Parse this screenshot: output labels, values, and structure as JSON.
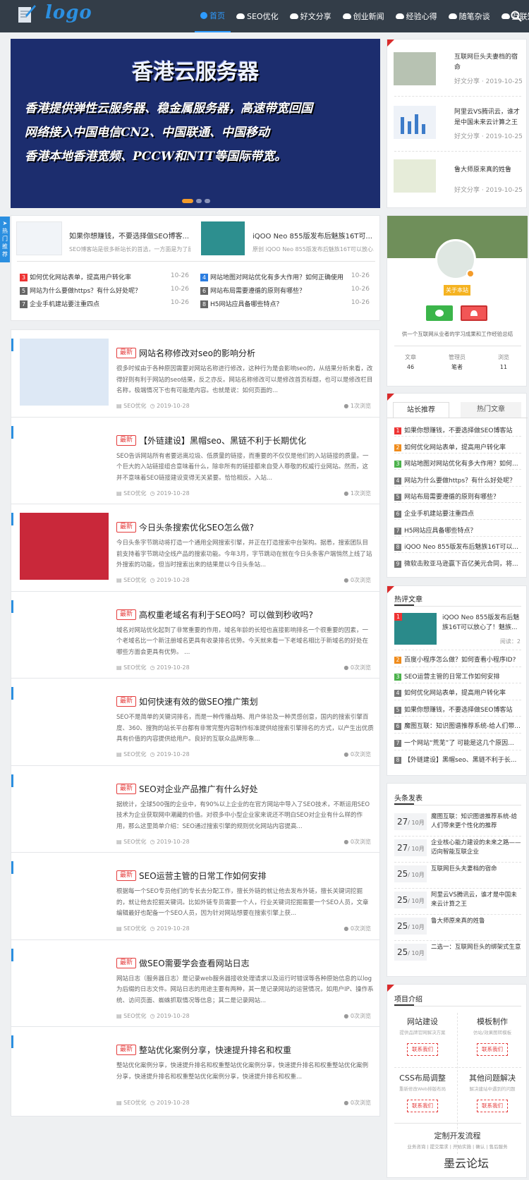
{
  "header": {
    "logo": "logo",
    "nav": [
      {
        "label": "首页"
      },
      {
        "label": "SEO优化"
      },
      {
        "label": "好文分享"
      },
      {
        "label": "创业新闻"
      },
      {
        "label": "经验心得"
      },
      {
        "label": "随笔杂谈"
      },
      {
        "label": "互联知识"
      }
    ]
  },
  "banner": {
    "title": "香港云服务器",
    "lines": [
      "香港提供弹性云服务器、稳金属服务器，高速带宽回国",
      "网络接入中国电信CN2、中国联通、中国移动",
      "香港本地香港宽频、PCCW和NTT等国际带宽。"
    ]
  },
  "recent_posts": [
    {
      "title": "互联网巨头夫妻档的宿命",
      "category": "好文分享",
      "date": "2019-10-25"
    },
    {
      "title": "阿里云VS腾讯云，谁才是中国未来云计算之王",
      "category": "好文分享",
      "date": "2019-10-25"
    },
    {
      "title": "鲁大师原来真的姓鲁",
      "category": "好文分享",
      "date": "2019-10-25"
    }
  ],
  "hot": {
    "tag": "热门推荐",
    "featured": [
      {
        "title": "如果你想赚钱，不要选择做SEO博客...",
        "desc": "SEO博客站是很多新站长的首选，一方面是为了展示..."
      },
      {
        "title": "iQOO Neo 855版发布后魅族16T可...",
        "desc": "原创 iQOO Neo 855版发布后魅族16T可以放心..."
      }
    ],
    "list": [
      {
        "n": "3",
        "title": "如何优化网站表单，提高用户转化率",
        "date": "10-26"
      },
      {
        "n": "4",
        "title": "网站地图对网站优化有多大作用？如何正确使用",
        "date": "10-26"
      },
      {
        "n": "5",
        "title": "网站为什么要做https？有什么好处呢？",
        "date": "10-26"
      },
      {
        "n": "6",
        "title": "网站布局需要遵循的原则有哪些？",
        "date": "10-26"
      },
      {
        "n": "7",
        "title": "企业手机建站要注重四点",
        "date": "10-26"
      },
      {
        "n": "8",
        "title": "H5网站应具备哪些特点？",
        "date": "10-26"
      }
    ]
  },
  "posts": [
    {
      "tag": "最新",
      "title": "网站名称修改对seo的影响分析",
      "excerpt": "很多时候由于各种原因需要对网站名称进行修改，这种行为是会影响seo的，从结果分析来看，改得好则有利于网站的seo结果，反之亦反。网站名称修改可以是修改首页标题，也可以是修改栏目名称，极端情况下也有可能是内容。也就是说：如何页面的...",
      "category": "SEO优化",
      "date": "2019-10-28",
      "views": "1次浏览"
    },
    {
      "tag": "最新",
      "title": "【外链建设】黑帽seo、黑链不利于长期优化",
      "excerpt": "SEO告诉网站所有者要远离垃圾、低质量的链接，而重要的不仅仅是他们的入站链接的质量。一个巨大的入站链接组合意味着什么，除非所有的链接都来自受人尊敬的权威行业网站。然而，这并不意味着SEO链接建设变得无关紧要。恰恰相反。入站...",
      "category": "SEO优化",
      "date": "2019-10-28",
      "views": "1次浏览"
    },
    {
      "tag": "最新",
      "title": "今日头条搜索优化SEO怎么做?",
      "excerpt": "今日头条字节跳动将打造一个通用全网搜索引擎，并正在打造搜索中台架构。据悉，搜索团队目前支持着字节跳动全线产品的搜索功能。今年3月，字节跳动在就在今日头条客户端悄然上线了站外搜索的功能，但当时搜索出来的结果是以今日头条站...",
      "category": "SEO优化",
      "date": "2019-10-28",
      "views": "0次浏览"
    },
    {
      "tag": "最新",
      "title": "高权重老域名有利于SEO吗？可以做到秒收吗?",
      "excerpt": "域名对网站优化起到了非常重要的作用，域名年龄的长短也直接影响排名一个很重要的因素，一个老域名比一个新注册域名更具有收录排名优势。今天就来看一下老域名相比于新域名的好处在哪些方面会更具有优势。 ...",
      "category": "SEO优化",
      "date": "2019-10-28",
      "views": "0次浏览"
    },
    {
      "tag": "最新",
      "title": "如何快速有效的做SEO推广策划",
      "excerpt": "SEO不是简单的关键词排名，而是一种传播战略、用户体验及一种灵感创意，国内的搜索引擎百度、360、搜狗的站长平台都有非常完整内容制作标准提供给搜索引擎排名的方式，以产生出优质具有价值的内容提供给用户。良好的互联众品牌形象...",
      "category": "SEO优化",
      "date": "2019-10-28",
      "views": "0次浏览"
    },
    {
      "tag": "最新",
      "title": "SEO对企业产品推广有什么好处",
      "excerpt": "据统计，全球500强的企业中，有90%以上企业的在官方网站中导入了SEO技术，不断运用SEO技术为企业获取网中潮藏的价值。对很多中小型企业家来说还不明白SEO对企业有什么样的作用，那么这里简单介绍：SEO通过搜索引擎的规则优化网站内容提高...",
      "category": "SEO优化",
      "date": "2019-10-28",
      "views": "0次浏览"
    },
    {
      "tag": "最新",
      "title": "SEO运营主管的日常工作如何安排",
      "excerpt": "根据每一个SEO专员他们的专长去分配工作，擅长外链的就让他去发布外链，擅长关键词挖掘的，就让他去挖掘关键词。比如外链专员需要一个人，行业关键词挖掘需要一个SEO人员，文章编辑最好也配备一个SEO人员，因为针对网站想要在搜索引擎上获...",
      "category": "SEO优化",
      "date": "2019-10-28",
      "views": "0次浏览"
    },
    {
      "tag": "最新",
      "title": "做SEO需要学会查看网站日志",
      "excerpt": "网站日志（服务器日志）是记录web服务器接收处理请求以及运行时错误等各种原始信息的以log为后缀的日志文件。网站日志的用途主要有两种，其一是记录网站的运营情况，如用户IP、操作系统、访问页面、蜘蛛抓取情况等信息；其二是记录网站...",
      "category": "SEO优化",
      "date": "2019-10-28",
      "views": "0次浏览"
    },
    {
      "tag": "最新",
      "title": "整站优化案例分享，快速提升排名和权重",
      "excerpt": "整站优化案例分享，快速提升排名和权重整站优化案例分享，快速提升排名和权重整站优化案例分享，快速提升排名和权重整站优化案例分享，快速提升排名和权重...",
      "category": "SEO优化",
      "date": "2019-10-28",
      "views": "0次浏览"
    }
  ],
  "profile": {
    "follow": "关于本站",
    "desc": "供一个互联网从业者的学习成果和工作经验总结",
    "stats": [
      {
        "label": "文章",
        "value": "46"
      },
      {
        "label": "管理员",
        "value": "笔者"
      },
      {
        "label": "浏览",
        "value": "11"
      }
    ]
  },
  "tabs": {
    "active": "站长推荐",
    "other": "热门文章",
    "items": [
      "如果你想赚钱，不要选择做SEO博客站",
      "如何优化网站表单，提高用户转化率",
      "网站地图对网站优化有多大作用？如何...",
      "网站为什么要做https？有什么好处呢？",
      "网站布局需要遵循的原则有哪些？",
      "企业手机建站要注重四点",
      "H5网站应具备哪些特点？",
      "iQOO Neo 855版发布后魅族16T可以...",
      "微软击败亚马逊赢下百亿美元合同，将..."
    ]
  },
  "hot_comments": {
    "title": "热评文章",
    "top": {
      "title": "iQOO Neo 855版发布后魅族16T可以放心了！魅族...",
      "views": "阅读：2"
    },
    "items": [
      "百度小程序怎么做？如何查看小程序ID?",
      "SEO运营主管的日常工作如何安排",
      "如何优化网站表单，提高用户转化率",
      "如果你想赚钱，不要选择做SEO博客站",
      "魔图互联：知识图谱推荐系统-给人们带...",
      "一个网站“荒芜”了 可能是这几个原因...",
      "【外链建设】黑帽seo、黑链不利于长..."
    ]
  },
  "headlines": {
    "title": "头条发表",
    "items": [
      {
        "day": "27",
        "mon": "10月",
        "title": "魔图互联：知识图谱推荐系统-给人们带来更个性化的推荐"
      },
      {
        "day": "27",
        "mon": "10月",
        "title": "企业核心能力建设的未来之路——迈向智能互联企业"
      },
      {
        "day": "25",
        "mon": "10月",
        "title": "互联网巨头夫妻档的宿命"
      },
      {
        "day": "25",
        "mon": "10月",
        "title": "阿里云VS腾讯云，谁才是中国未来云计算之王"
      },
      {
        "day": "25",
        "mon": "10月",
        "title": "鲁大师原来真的姓鲁"
      },
      {
        "day": "25",
        "mon": "10月",
        "title": "二选一：互联网巨头的绑架式生意"
      }
    ]
  },
  "services": {
    "title": "项目介绍",
    "items": [
      {
        "name": "网站建设",
        "sub": "提供品牌官网解决方案",
        "btn": "联系我们"
      },
      {
        "name": "模板制作",
        "sub": "仿站/效果图转模板",
        "btn": "联系我们"
      },
      {
        "name": "CSS布局调整",
        "sub": "重新修改Web排版布局",
        "btn": "联系我们"
      },
      {
        "name": "其他问题解决",
        "sub": "解决建站中遇到的问题",
        "btn": "联系我们"
      }
    ],
    "flow_title": "定制开发流程",
    "flow": "业务咨询 | 提交需求 | 开始实施 | 确认 | 售后服务",
    "watermark": "墨云论坛"
  }
}
